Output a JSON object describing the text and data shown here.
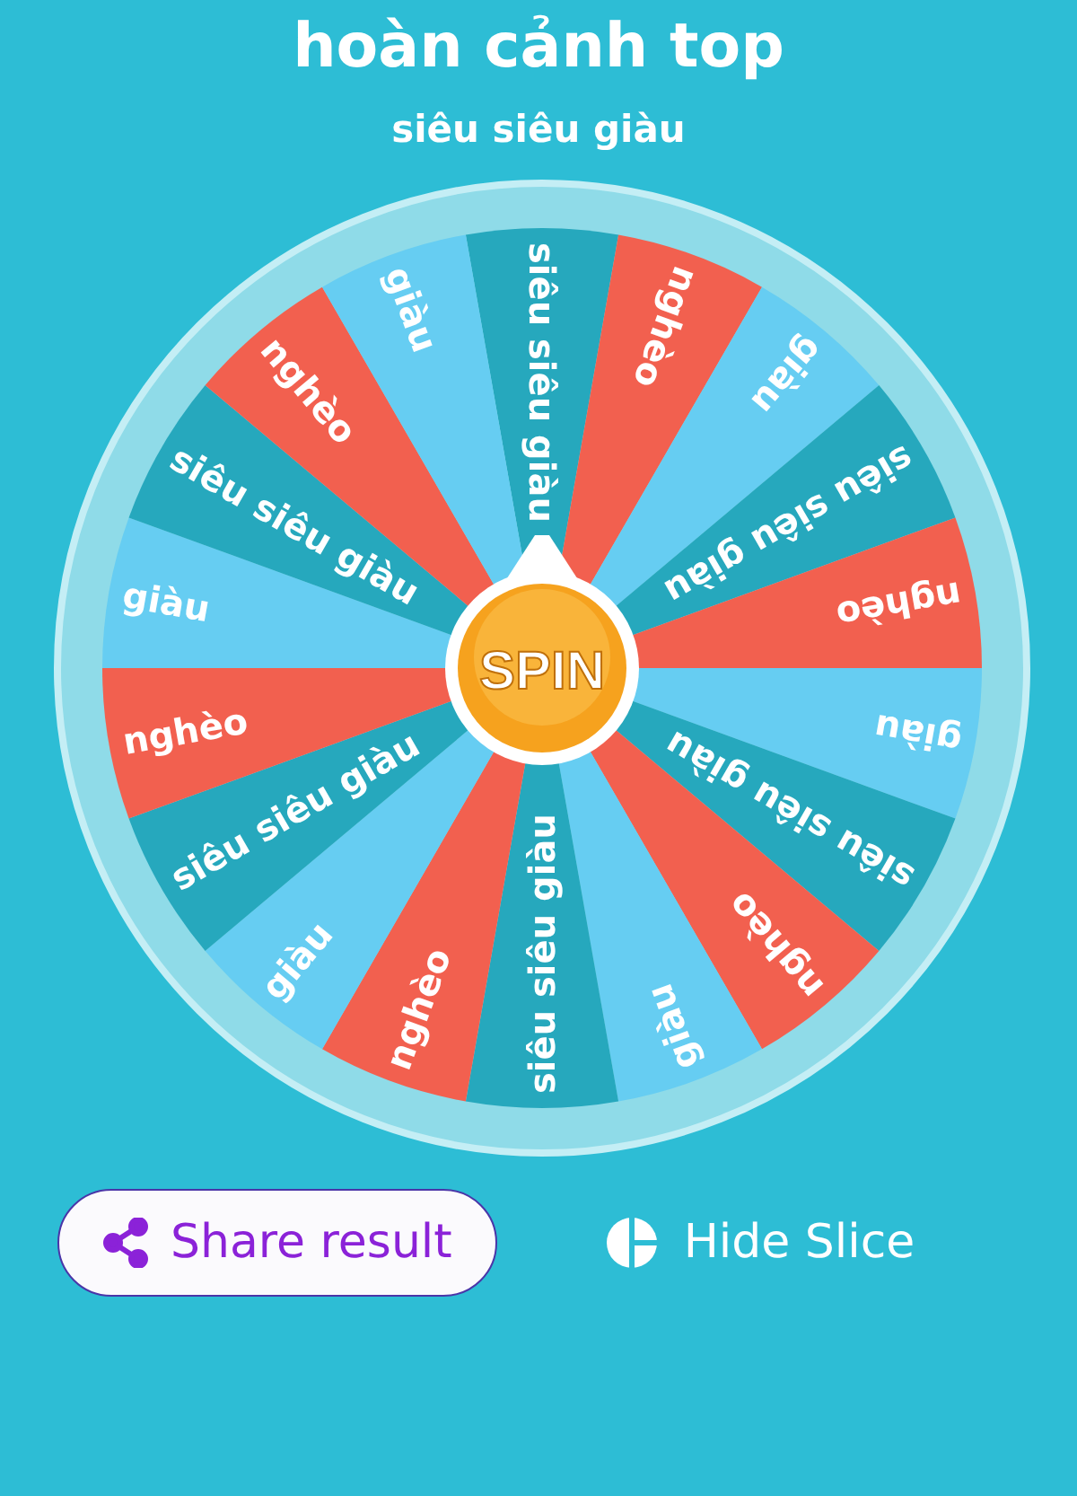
{
  "title": "hoàn cảnh top",
  "subtitle": "siêu siêu giàu",
  "wheel": {
    "center_button": "SPIN",
    "slices": [
      {
        "label": "siêu siêu giàu",
        "color": "#26a8bd"
      },
      {
        "label": "nghèo",
        "color": "#f2604f"
      },
      {
        "label": "giàu",
        "color": "#66cdf2"
      },
      {
        "label": "siêu siêu giàu",
        "color": "#26a8bd"
      },
      {
        "label": "nghèo",
        "color": "#f2604f"
      },
      {
        "label": "giàu",
        "color": "#66cdf2"
      },
      {
        "label": "siêu siêu giàu",
        "color": "#26a8bd"
      },
      {
        "label": "nghèo",
        "color": "#f2604f"
      },
      {
        "label": "giàu",
        "color": "#66cdf2"
      },
      {
        "label": "siêu siêu giàu",
        "color": "#26a8bd"
      },
      {
        "label": "nghèo",
        "color": "#f2604f"
      },
      {
        "label": "giàu",
        "color": "#66cdf2"
      },
      {
        "label": "siêu siêu giàu",
        "color": "#26a8bd"
      },
      {
        "label": "nghèo",
        "color": "#f2604f"
      },
      {
        "label": "giàu",
        "color": "#66cdf2"
      },
      {
        "label": "siêu siêu giàu",
        "color": "#26a8bd"
      },
      {
        "label": "nghèo",
        "color": "#f2604f"
      },
      {
        "label": "giàu",
        "color": "#66cdf2"
      }
    ]
  },
  "share_button": "Share result",
  "hide_slice_button": "Hide Slice"
}
